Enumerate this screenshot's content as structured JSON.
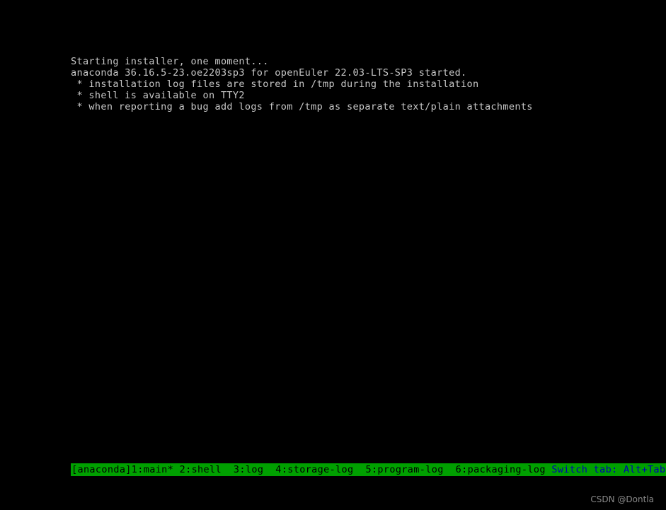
{
  "screen": {
    "background_color": "#000000",
    "text_color": "#c8c8c8"
  },
  "console": {
    "lines": [
      "Starting installer, one moment...",
      "anaconda 36.16.5-23.oe2203sp3 for openEuler 22.03-LTS-SP3 started.",
      " * installation log files are stored in /tmp during the installation",
      " * shell is available on TTY2",
      " * when reporting a bug add logs from /tmp as separate text/plain attachments"
    ]
  },
  "status_bar": {
    "background_color": "#00a000",
    "text_color": "#000000",
    "hint_color": "#0000b4",
    "session_label": "[anaconda]",
    "tabs": [
      {
        "label": "1:main*",
        "active": true
      },
      {
        "label": "2:shell",
        "active": false
      },
      {
        "label": "3:log",
        "active": false
      },
      {
        "label": "4:storage-log",
        "active": false
      },
      {
        "label": "5:program-log",
        "active": false
      },
      {
        "label": "6:packaging-log",
        "active": false
      }
    ],
    "separator_first": " ",
    "separator": "  ",
    "hint": "Switch tab: Alt+Tab"
  },
  "watermark": {
    "text": "CSDN @Dontla"
  }
}
